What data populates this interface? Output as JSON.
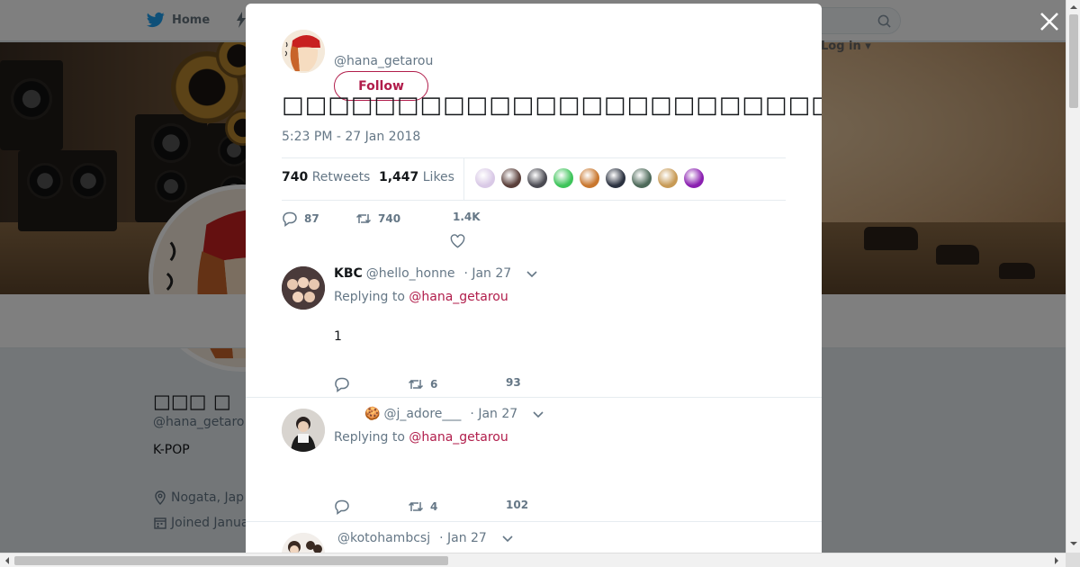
{
  "nav": {
    "home_label": "Home",
    "login_label": "Log in"
  },
  "profile": {
    "display_name": "□□□ □",
    "handle": "@hana_getaro",
    "bio": "K-POP",
    "location": "Nogata, Jap",
    "joined": "Joined Janua"
  },
  "tweet": {
    "author_handle": "@hana_getarou",
    "follow_label": "Follow",
    "text": "□□□□□□□□□□□□□□□□□□□□□□□□□□□□□□□□□□□□□□□□□□□□□□□□□□□□□□□□□□□□□□",
    "timestamp": "5:23 PM - 27 Jan 2018",
    "retweet_count": "740",
    "retweet_label": "Retweets",
    "like_count": "1,447",
    "like_label": "Likes",
    "liker_colors": [
      "#d9c9e6",
      "#5a3f3a",
      "#4a4a52",
      "#3ec45a",
      "#c9772e",
      "#2b3240",
      "#4e6a5a",
      "#c79a55",
      "#8a1fb0"
    ],
    "actions": {
      "reply_count": "87",
      "retweet_count": "740",
      "like_count": "1.4K"
    }
  },
  "replies": [
    {
      "name": "KBC",
      "handle": "@hello_honne",
      "date": "· Jan 27",
      "replying_prefix": "Replying to",
      "replying_to": "@hana_getarou",
      "body": "1",
      "retweets": "6",
      "likes": "93"
    },
    {
      "name": "🍪",
      "handle": "@j_adore___",
      "date": "· Jan 27",
      "replying_prefix": "Replying to",
      "replying_to": "@hana_getarou",
      "body": "",
      "retweets": "4",
      "likes": "102"
    },
    {
      "name": "",
      "handle": "@kotohambcsj",
      "date": "· Jan 27"
    }
  ],
  "colors": {
    "accent": "#b11d4b",
    "muted": "#657786",
    "twitter_blue": "#1da1f2"
  }
}
